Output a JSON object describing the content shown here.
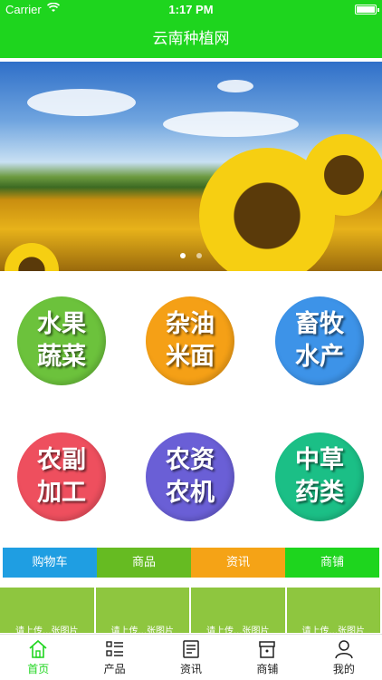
{
  "status_bar": {
    "carrier": "Carrier",
    "time": "1:17 PM"
  },
  "nav": {
    "title": "云南种植网"
  },
  "categories": [
    {
      "line1": "水果",
      "line2": "蔬菜",
      "color": "#6cc23c"
    },
    {
      "line1": "杂油",
      "line2": "米面",
      "color": "#f5a016"
    },
    {
      "line1": "畜牧",
      "line2": "水产",
      "color": "#3d93e8"
    },
    {
      "line1": "农副",
      "line2": "加工",
      "color": "#ee4f5e"
    },
    {
      "line1": "农资",
      "line2": "农机",
      "color": "#6a5fd6"
    },
    {
      "line1": "中草",
      "line2": "药类",
      "color": "#1bbf86"
    }
  ],
  "quick_tabs": [
    {
      "label": "购物车",
      "color": "#1f9ee2"
    },
    {
      "label": "商品",
      "color": "#66bb22"
    },
    {
      "label": "资讯",
      "color": "#f5a316"
    },
    {
      "label": "商铺",
      "color": "#1ed51e"
    }
  ],
  "products": [
    {
      "caption": "请上传...张图片"
    },
    {
      "caption": "请上传...张图片"
    },
    {
      "caption": "请上传...张图片"
    },
    {
      "caption": "请上传...张图片"
    }
  ],
  "tab_bar": [
    {
      "label": "首页",
      "icon": "home-icon",
      "active": true
    },
    {
      "label": "产品",
      "icon": "list-icon",
      "active": false
    },
    {
      "label": "资讯",
      "icon": "news-icon",
      "active": false
    },
    {
      "label": "商铺",
      "icon": "store-icon",
      "active": false
    },
    {
      "label": "我的",
      "icon": "user-icon",
      "active": false
    }
  ],
  "colors": {
    "brand_green": "#1ed51e",
    "active_tab": "#1ed51e"
  }
}
